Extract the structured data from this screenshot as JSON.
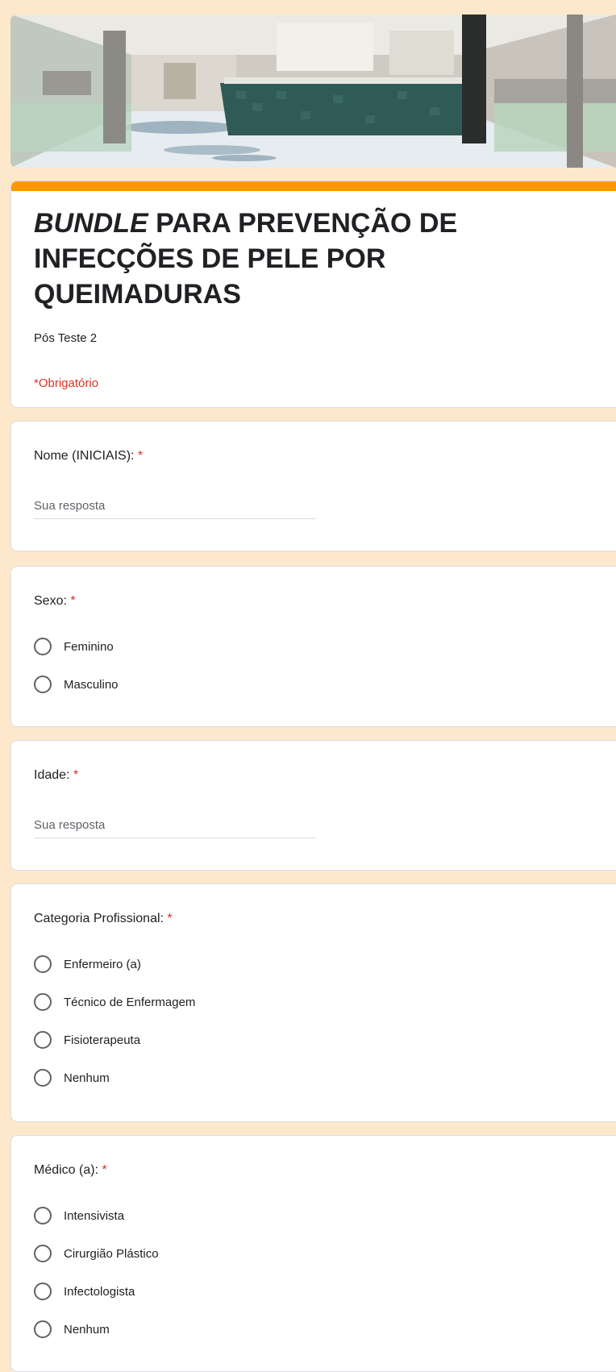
{
  "form": {
    "title_emphasis": "BUNDLE",
    "title_rest": " PARA PREVENÇÃO DE INFECÇÕES DE PELE POR QUEIMADURAS",
    "description": "Pós Teste 2",
    "required_note": "*Obrigatório"
  },
  "colors": {
    "accent": "#ff9800",
    "page_background": "#fde8cb",
    "required": "#d93025"
  },
  "questions": {
    "nome": {
      "label": "Nome (INICIAIS):",
      "required_mark": "*",
      "placeholder": "Sua resposta"
    },
    "sexo": {
      "label": "Sexo:",
      "required_mark": "*",
      "options": [
        "Feminino",
        "Masculino"
      ]
    },
    "idade": {
      "label": "Idade:",
      "required_mark": "*",
      "placeholder": "Sua resposta"
    },
    "categoria": {
      "label": "Categoria Profissional:",
      "required_mark": "*",
      "options": [
        "Enfermeiro (a)",
        "Técnico de Enfermagem",
        "Fisioterapeuta",
        "Nenhum"
      ]
    },
    "medico": {
      "label": "Médico (a):",
      "required_mark": "*",
      "options": [
        "Intensivista",
        "Cirurgião Plástico",
        "Infectologista",
        "Nenhum"
      ]
    }
  }
}
